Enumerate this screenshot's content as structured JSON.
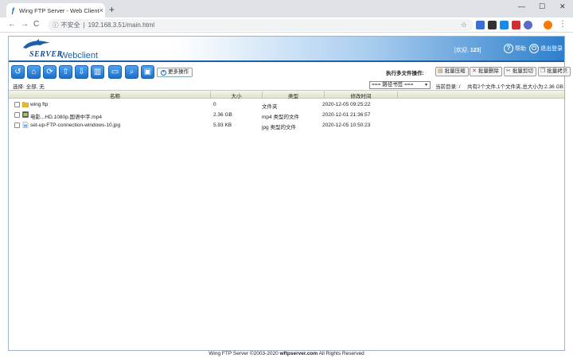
{
  "browser": {
    "tab_title": "Wing FTP Server - Web Client",
    "tab_close": "×",
    "new_tab": "+",
    "minimize": "—",
    "maximize": "☐",
    "close": "✕",
    "back": "←",
    "forward": "→",
    "reload": "C",
    "security_label": "不安全",
    "url": "192.168.3.51/main.html",
    "star": "☆"
  },
  "header": {
    "logo_server": "SERVER",
    "logo_webclient": "Webclient",
    "welcome_prefix": "[欢迎, ",
    "welcome_user": "123",
    "welcome_suffix": "]",
    "help_label": "帮助",
    "logout_label": "退出登录"
  },
  "toolbar": {
    "more_label": "更多操作",
    "multi_label": "执行多文件操作:",
    "batch_compress": "批量压缩",
    "batch_delete": "批量删除",
    "batch_cut": "批量剪切",
    "batch_copy": "批量拷贝"
  },
  "selection": {
    "text": "选择: 全部, 无",
    "bookmark_select": "=== 路径书签 ===",
    "current_dir_label": "当前目录: /",
    "summary": "共有2个文件,1个文件夹,总大小为:2.36 GB"
  },
  "table": {
    "headers": {
      "name": "名称",
      "size": "大小",
      "type": "类型",
      "modified": "修改时间"
    },
    "rows": [
      {
        "name": "wing ftp",
        "size": "0",
        "type": "文件夹",
        "modified": "2020-12-05 09:25:22",
        "kind": "folder-icon"
      },
      {
        "name": "电影...HD.1080p.国语中字.mp4",
        "size": "2.36 GB",
        "type": "mp4 类型的文件",
        "modified": "2020-12-01 21:36:57",
        "kind": "video-file-icon"
      },
      {
        "name": "set-up-FTP-connection-windows-10.jpg",
        "size": "5.93 KB",
        "type": "jpg 类型的文件",
        "modified": "2020-12-05 10:50:23",
        "kind": "image-file-icon"
      }
    ]
  },
  "footer": {
    "prefix": "Wing FTP Server ©2003-2020 ",
    "site": "wftpserver.com",
    "suffix": " All Rights Reserved"
  },
  "colors": {
    "accent": "#1f5fa3",
    "button_blue": "#2a7fd6",
    "table_header": "#e6e9d4"
  }
}
